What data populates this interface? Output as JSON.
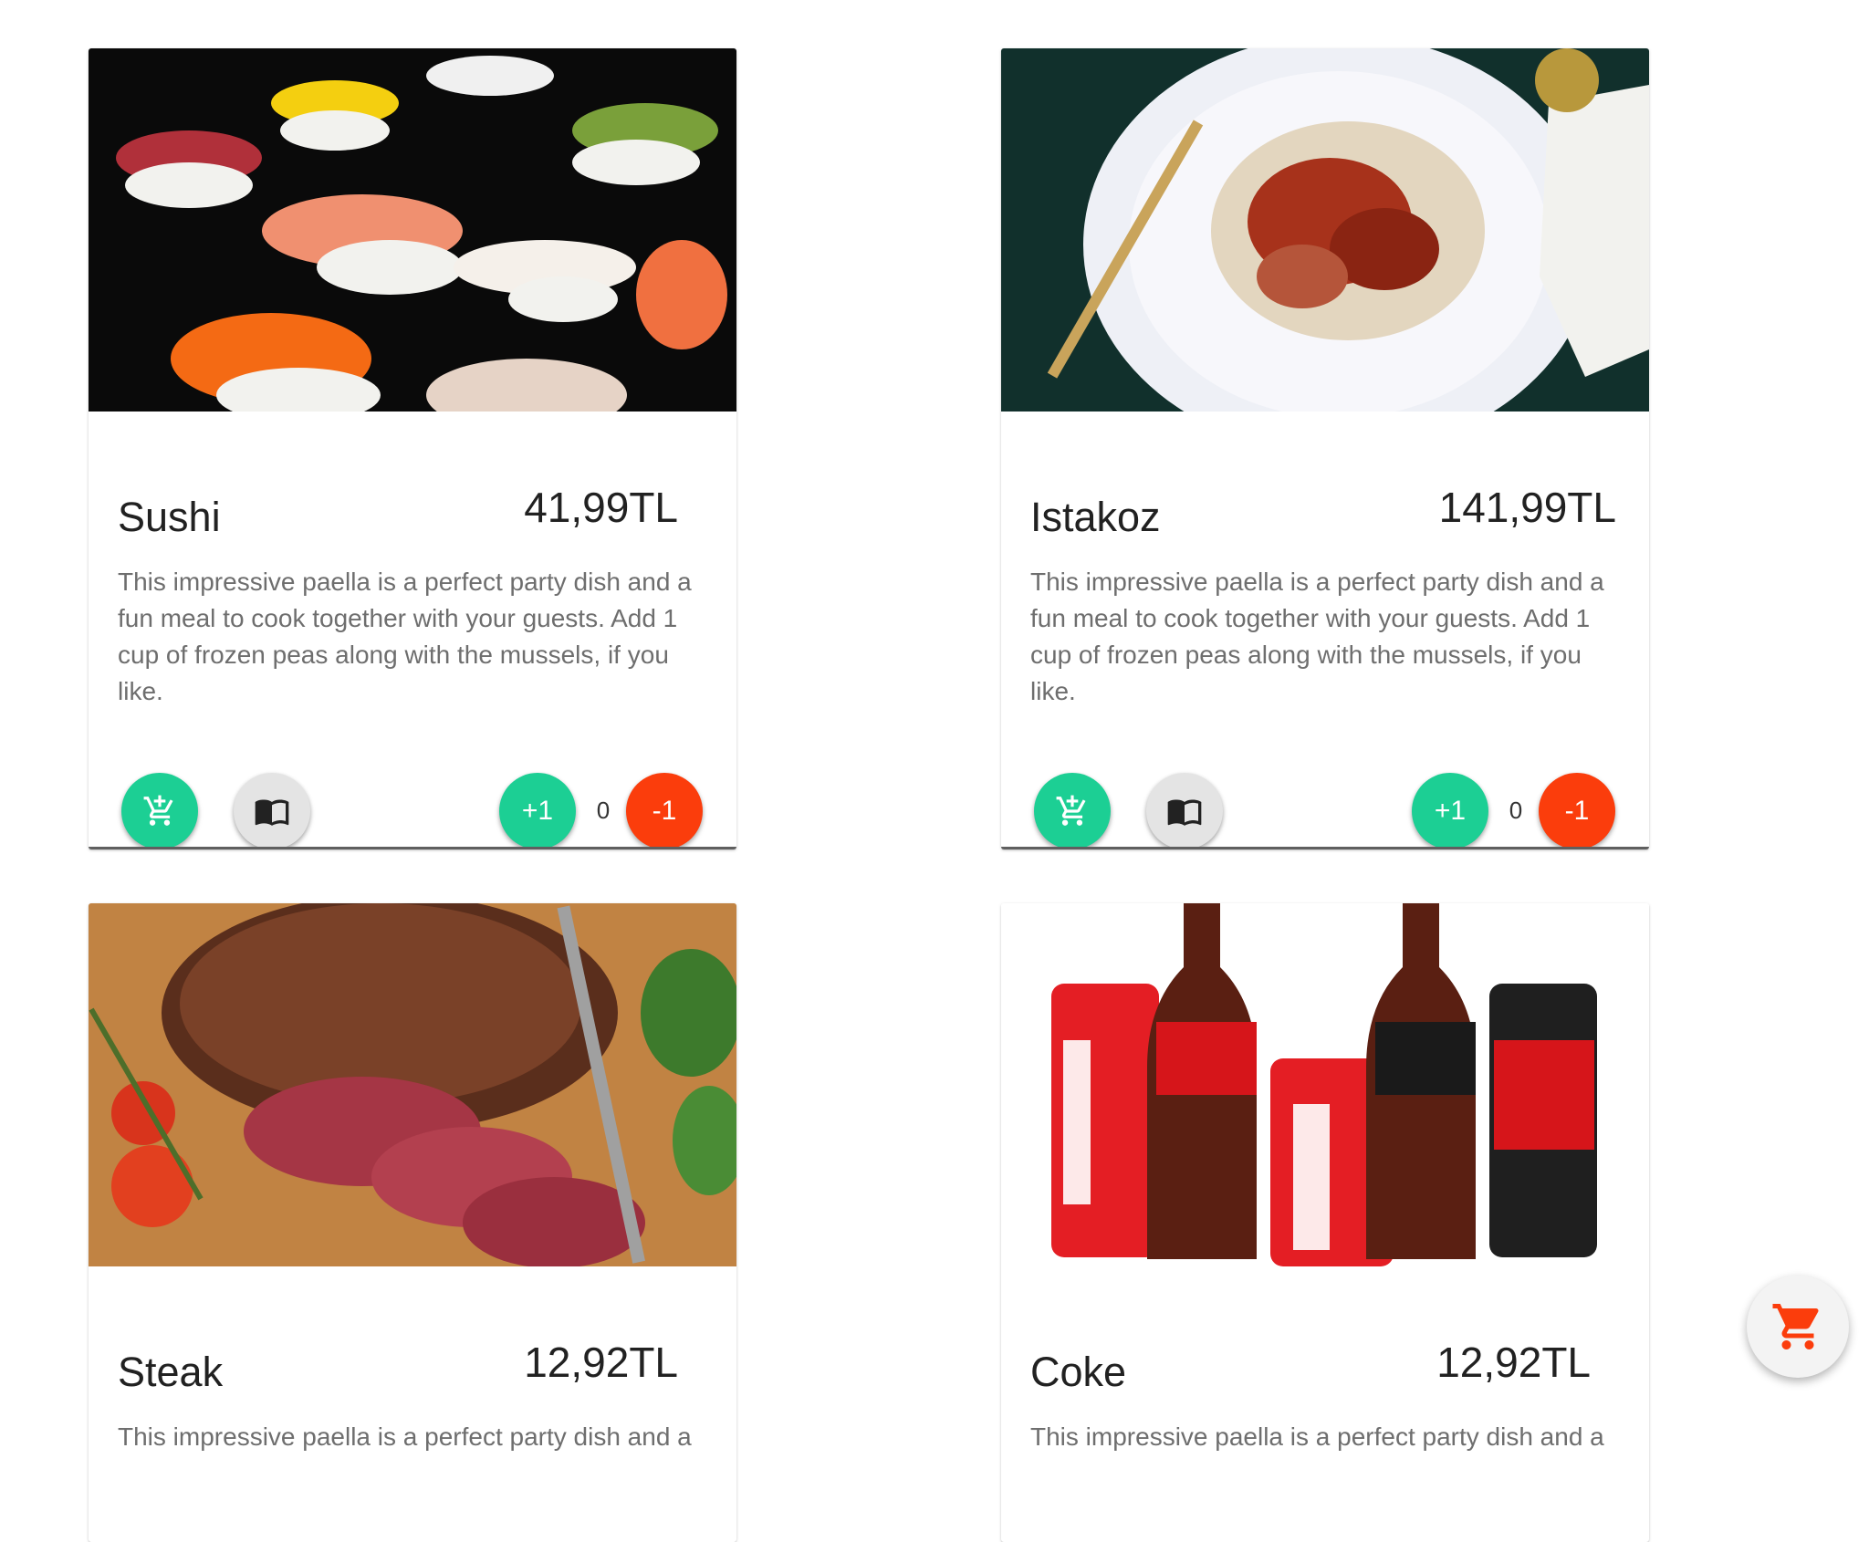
{
  "cards": [
    {
      "title": "Sushi",
      "price": "41,99TL",
      "description": "This impressive paella is a perfect party dish and a fun meal to cook together with your guests. Add 1 cup of frozen peas along with the mussels, if you like.",
      "quantity": "0",
      "plus_label": "+1",
      "minus_label": "-1",
      "cart_icon": "add-shopping-cart-icon",
      "recipe_icon": "book-icon"
    },
    {
      "title": "Istakoz",
      "price": "141,99TL",
      "description": "This impressive paella is a perfect party dish and a fun meal to cook together with your guests. Add 1 cup of frozen peas along with the mussels, if you like.",
      "quantity": "0",
      "plus_label": "+1",
      "minus_label": "-1",
      "cart_icon": "add-shopping-cart-icon",
      "recipe_icon": "book-icon"
    },
    {
      "title": "Steak",
      "price": "12,92TL",
      "description": "This impressive paella is a perfect party dish and a"
    },
    {
      "title": "Coke",
      "price": "12,92TL",
      "description": "This impressive paella is a perfect party dish and a"
    }
  ],
  "floating_cart": {
    "icon": "shopping-cart-icon"
  },
  "colors": {
    "green": "#1ccf94",
    "red": "#fb3d0c",
    "grey": "#e4e4e4",
    "cart_orange": "#fb3d0c"
  }
}
